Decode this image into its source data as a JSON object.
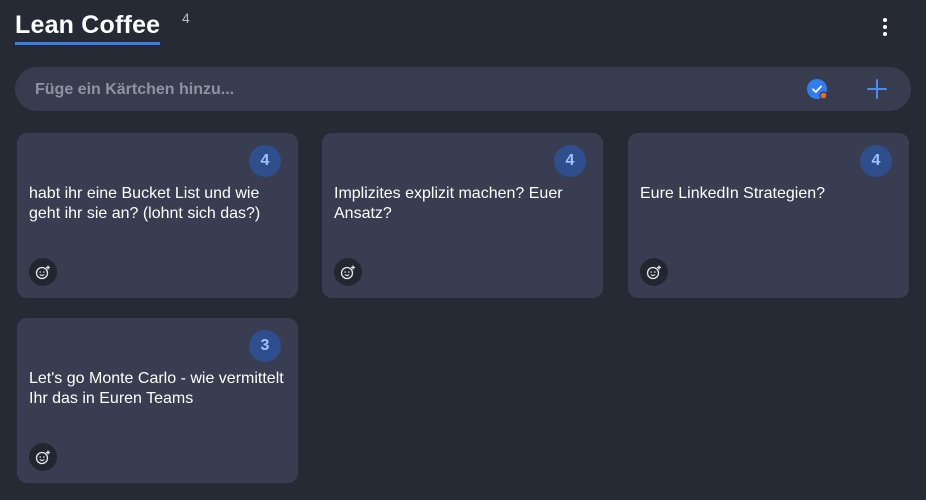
{
  "header": {
    "title": "Lean Coffee",
    "count": "4"
  },
  "add_card": {
    "placeholder": "Füge ein Kärtchen hinzu..."
  },
  "icons": {
    "menu": "more-vertical-icon",
    "check": "check-circle-icon",
    "add": "plus-icon",
    "reaction": "add-emoji-icon"
  },
  "colors": {
    "background": "#252a35",
    "card": "#383d51",
    "accent": "#3d7be5",
    "vote_badge": "#2f4e8c",
    "status_dot": "#e46b2f"
  },
  "cards": [
    {
      "votes": "4",
      "text": "habt ihr eine Bucket List und wie geht ihr sie an? (lohnt sich das?)"
    },
    {
      "votes": "4",
      "text": "Implizites explizit machen? Euer Ansatz?"
    },
    {
      "votes": "4",
      "text": "Eure LinkedIn Strategien?"
    },
    {
      "votes": "3",
      "text": "Let's go Monte Carlo - wie vermittelt Ihr das in Euren Teams"
    }
  ]
}
